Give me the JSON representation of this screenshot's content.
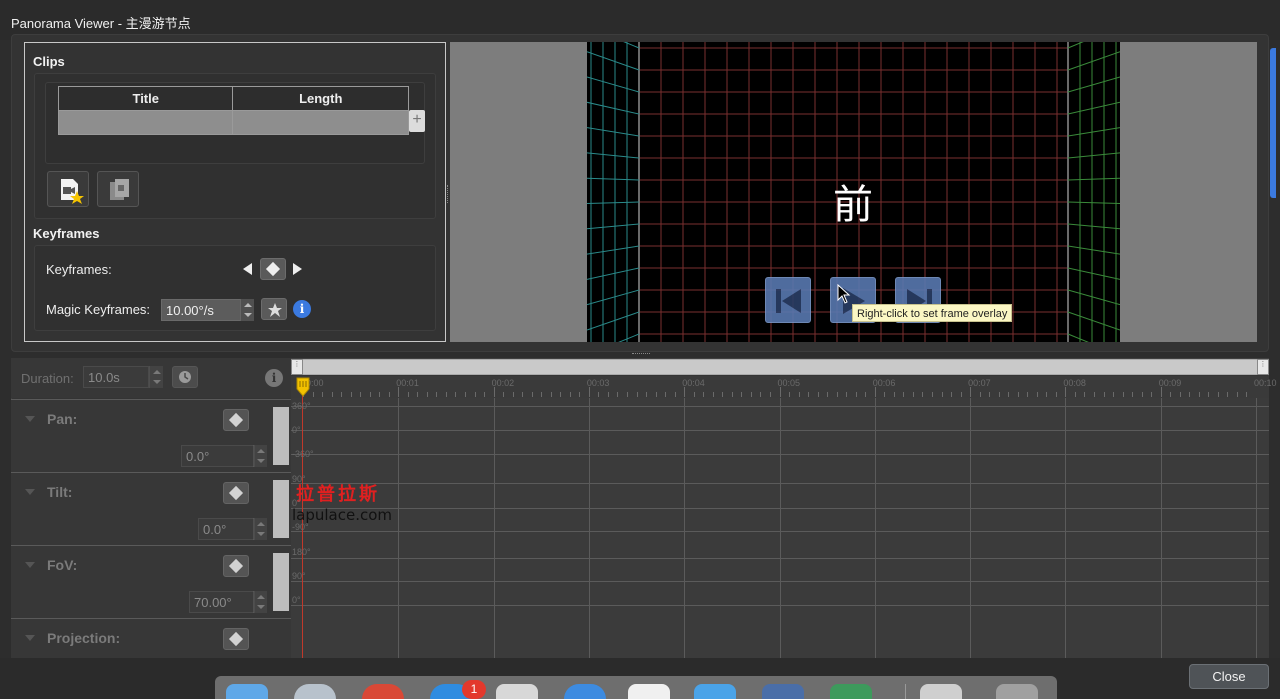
{
  "window": {
    "title": "Panorama Viewer - 主漫游节点"
  },
  "clips": {
    "heading": "Clips",
    "columns": [
      "Title",
      "Length"
    ],
    "add_label": "+",
    "new_clip_icon": "new-clip-icon",
    "duplicate_clip_icon": "duplicate-clip-icon"
  },
  "keyframes": {
    "heading": "Keyframes",
    "keyframes_label": "Keyframes:",
    "magic_label": "Magic Keyframes:",
    "magic_value": "10.00°/s"
  },
  "viewer": {
    "face_label": "前",
    "tooltip": "Right-click to set frame overlay"
  },
  "watermark": {
    "chinese": "拉普拉斯",
    "site": "lapulace.com"
  },
  "timeline": {
    "duration_label": "Duration:",
    "duration_value": "10.0s",
    "ticks": [
      "00:00",
      "00:01",
      "00:02",
      "00:03",
      "00:04",
      "00:05",
      "00:06",
      "00:07",
      "00:08",
      "00:09",
      "00:10"
    ],
    "tracks": [
      {
        "name": "Pan:",
        "value": "0.0°",
        "scale": [
          "360°",
          "0°",
          "-360°"
        ]
      },
      {
        "name": "Tilt:",
        "value": "0.0°",
        "scale": [
          "90°",
          "0°",
          "-90°"
        ]
      },
      {
        "name": "FoV:",
        "value": "70.00°",
        "scale": [
          "180°",
          "90°",
          "0°"
        ]
      },
      {
        "name": "Projection:"
      }
    ]
  },
  "footer": {
    "close_label": "Close",
    "dock_badge": "1"
  }
}
